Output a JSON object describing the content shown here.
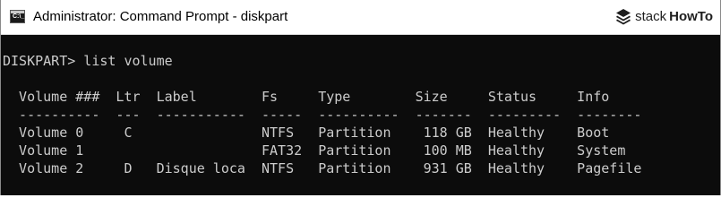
{
  "window": {
    "title": "Administrator: Command Prompt - diskpart",
    "app_icon_text": "C:\\_",
    "brand": {
      "part1": "stack",
      "part2": "HowTo"
    }
  },
  "console": {
    "lines": [
      "DISKPART> list volume",
      "",
      "  Volume ###  Ltr  Label        Fs     Type        Size     Status     Info",
      "  ----------  ---  -----------  -----  ----------  -------  ---------  --------",
      "  Volume 0     C                NTFS   Partition    118 GB  Healthy    Boot",
      "  Volume 1                      FAT32  Partition    100 MB  Healthy    System",
      "  Volume 2     D   Disque loca  NTFS   Partition    931 GB  Healthy    Pagefile"
    ]
  }
}
